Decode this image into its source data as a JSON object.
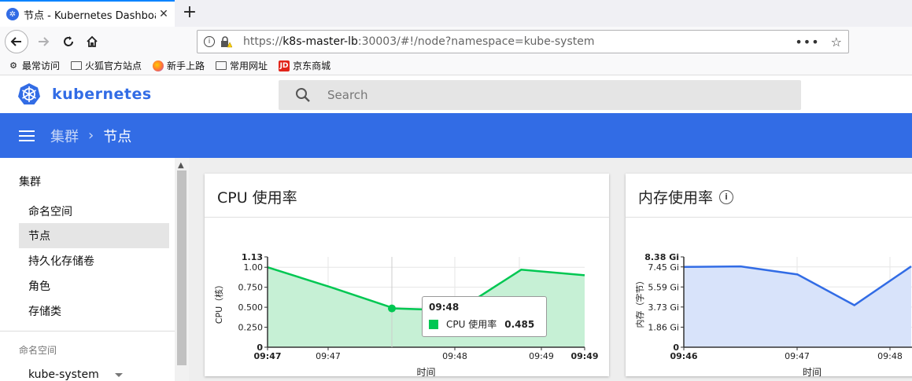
{
  "browser": {
    "tab_title": "节点 - Kubernetes Dashboard",
    "url_scheme": "https://",
    "url_host": "k8s-master-lb",
    "url_rest": ":30003/#!/node?namespace=kube-system",
    "bookmarks": [
      {
        "label": "最常访问",
        "icon": "gear-icon"
      },
      {
        "label": "火狐官方站点",
        "icon": "folder-icon"
      },
      {
        "label": "新手上路",
        "icon": "firefox-icon"
      },
      {
        "label": "常用网址",
        "icon": "folder-icon"
      },
      {
        "label": "京东商城",
        "icon": "jd-icon"
      }
    ]
  },
  "header": {
    "brand": "kubernetes",
    "search_placeholder": "Search",
    "brand_color": "#326ce5"
  },
  "breadcrumb": {
    "parent": "集群",
    "separator": "›",
    "current": "节点"
  },
  "sidebar": {
    "heading": "集群",
    "items": [
      {
        "label": "命名空间",
        "active": false
      },
      {
        "label": "节点",
        "active": true
      },
      {
        "label": "持久化存储卷",
        "active": false
      },
      {
        "label": "角色",
        "active": false
      },
      {
        "label": "存储类",
        "active": false
      }
    ],
    "namespace_heading": "命名空间",
    "namespace_value": "kube-system"
  },
  "cards": {
    "cpu_title": "CPU 使用率",
    "mem_title": "内存使用率"
  },
  "tooltip": {
    "time": "09:48",
    "series": "CPU 使用率",
    "value": "0.485"
  },
  "chart_data": [
    {
      "type": "area",
      "title": "CPU 使用率",
      "xlabel": "时间",
      "ylabel": "CPU（核）",
      "color": "#00c752",
      "fill": "#c6f0d5",
      "y_ticks": [
        "0",
        "0.250",
        "0.500",
        "0.750",
        "1.00",
        "1.13"
      ],
      "ylim": [
        0,
        1.13
      ],
      "x_ticks": [
        "09:47",
        "09:47",
        "09:48",
        "09:49",
        "09:49"
      ],
      "series": [
        {
          "name": "CPU 使用率",
          "values": [
            1.0,
            0.75,
            0.485,
            0.46,
            0.97,
            0.9
          ]
        }
      ]
    },
    {
      "type": "area",
      "title": "内存使用率",
      "xlabel": "时间",
      "ylabel": "内存（字节）",
      "color": "#326ce5",
      "fill": "#d8e3fa",
      "y_ticks": [
        "0",
        "1.86 Gi",
        "3.73 Gi",
        "5.59 Gi",
        "7.45 Gi",
        "8.38 Gi"
      ],
      "ylim": [
        0,
        8.38
      ],
      "x_ticks": [
        "09:46",
        "09:47",
        "09:48"
      ],
      "series": [
        {
          "values": [
            7.45,
            7.5,
            6.75,
            3.9,
            7.5
          ]
        }
      ]
    }
  ]
}
